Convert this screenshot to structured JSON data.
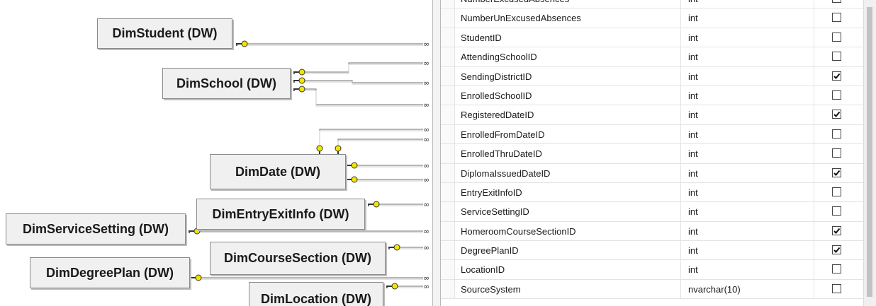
{
  "diagram": {
    "tables": [
      {
        "id": "student",
        "label": "DimStudent (DW)"
      },
      {
        "id": "school",
        "label": "DimSchool (DW)"
      },
      {
        "id": "date",
        "label": "DimDate (DW)"
      },
      {
        "id": "entryexit",
        "label": "DimEntryExitInfo (DW)"
      },
      {
        "id": "servicesetting",
        "label": "DimServiceSetting (DW)"
      },
      {
        "id": "coursesection",
        "label": "DimCourseSection (DW)"
      },
      {
        "id": "degreeplan",
        "label": "DimDegreePlan (DW)"
      },
      {
        "id": "location",
        "label": "DimLocation (DW)"
      }
    ],
    "colors": {
      "key_icon": "#f2e600",
      "connector": "#6e6e6e",
      "table_bg": "#f0f0f0"
    }
  },
  "grid": {
    "rows": [
      {
        "name": "NumberExcusedAbsences",
        "type": "int",
        "allow_nulls": false
      },
      {
        "name": "NumberUnExcusedAbsences",
        "type": "int",
        "allow_nulls": false
      },
      {
        "name": "StudentID",
        "type": "int",
        "allow_nulls": false
      },
      {
        "name": "AttendingSchoolID",
        "type": "int",
        "allow_nulls": false
      },
      {
        "name": "SendingDistrictID",
        "type": "int",
        "allow_nulls": true
      },
      {
        "name": "EnrolledSchoolID",
        "type": "int",
        "allow_nulls": false
      },
      {
        "name": "RegisteredDateID",
        "type": "int",
        "allow_nulls": true
      },
      {
        "name": "EnrolledFromDateID",
        "type": "int",
        "allow_nulls": false
      },
      {
        "name": "EnrolledThruDateID",
        "type": "int",
        "allow_nulls": false
      },
      {
        "name": "DiplomaIssuedDateID",
        "type": "int",
        "allow_nulls": true
      },
      {
        "name": "EntryExitInfoID",
        "type": "int",
        "allow_nulls": false
      },
      {
        "name": "ServiceSettingID",
        "type": "int",
        "allow_nulls": false
      },
      {
        "name": "HomeroomCourseSectionID",
        "type": "int",
        "allow_nulls": true
      },
      {
        "name": "DegreePlanID",
        "type": "int",
        "allow_nulls": true
      },
      {
        "name": "LocationID",
        "type": "int",
        "allow_nulls": false
      },
      {
        "name": "SourceSystem",
        "type": "nvarchar(10)",
        "allow_nulls": false
      }
    ]
  }
}
